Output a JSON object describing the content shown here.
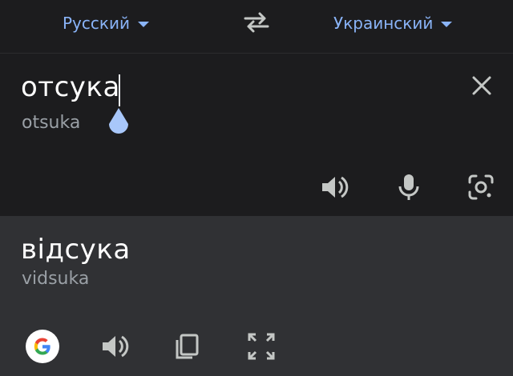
{
  "languages": {
    "source": "Русский",
    "target": "Украинский"
  },
  "input": {
    "text": "отсука",
    "transliteration": "otsuka"
  },
  "output": {
    "text": "відсука",
    "transliteration": "vidsuka"
  },
  "colors": {
    "accent": "#8ab4f8",
    "background": "#1c1c1e",
    "output_background": "#303134",
    "icon": "#c4c7c5"
  }
}
